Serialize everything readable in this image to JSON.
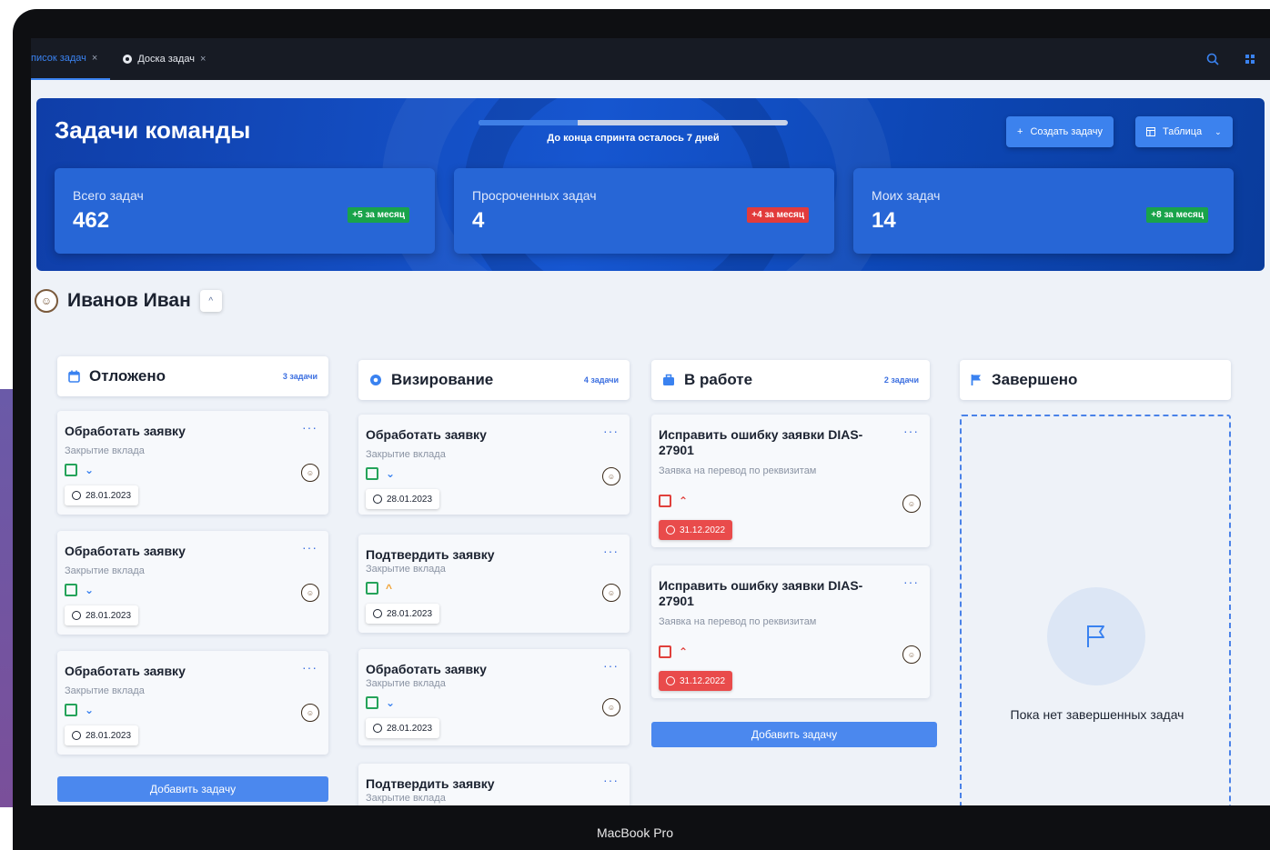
{
  "tabs": [
    {
      "label": "писок задач",
      "close": "×"
    },
    {
      "label": "Доска задач",
      "close": "×"
    }
  ],
  "header": {
    "title": "Задачи команды",
    "sprint_text": "До конца спринта осталось 7 дней",
    "sprint_progress": 0.32,
    "create_button": "Создать задачу",
    "view_button": "Таблица"
  },
  "stats": [
    {
      "label": "Всего задач",
      "value": "462",
      "badge": "+5 за месяц",
      "badge_color": "#19a34a"
    },
    {
      "label": "Просроченных задач",
      "value": "4",
      "badge": "+4 за месяц",
      "badge_color": "#e23b3b"
    },
    {
      "label": "Моих задач",
      "value": "14",
      "badge": "+8 за месяц",
      "badge_color": "#19a34a"
    }
  ],
  "user": {
    "name": "Иванов Иван"
  },
  "columns": [
    {
      "title": "Отложено",
      "count": "3 задачи",
      "icon": "calendar-icon",
      "cards": [
        {
          "title": "Обработать заявку",
          "subtitle": "Закрытие вклада",
          "date": "28.01.2023"
        },
        {
          "title": "Обработать заявку",
          "subtitle": "Закрытие вклада",
          "date": "28.01.2023"
        },
        {
          "title": "Обработать заявку",
          "subtitle": "Закрытие вклада",
          "date": "28.01.2023"
        }
      ],
      "add_label": "Добавить задачу"
    },
    {
      "title": "Визирование",
      "count": "4 задачи",
      "icon": "eye-icon",
      "cards": [
        {
          "title": "Обработать заявку",
          "subtitle": "Закрытие вклада",
          "date": "28.01.2023"
        },
        {
          "title": "Подтвердить заявку",
          "subtitle": "Закрытие вклада",
          "date": "28.01.2023"
        },
        {
          "title": "Обработать заявку",
          "subtitle": "Закрытие вклада",
          "date": "28.01.2023"
        },
        {
          "title": "Подтвердить заявку",
          "subtitle": "Закрытие вклада"
        }
      ]
    },
    {
      "title": "В работе",
      "count": "2 задачи",
      "icon": "briefcase-icon",
      "cards": [
        {
          "title": "Исправить ошибку заявки DIAS-27901",
          "subtitle": "Заявка на перевод по реквизитам",
          "date": "31.12.2022"
        },
        {
          "title": "Исправить ошибку заявки DIAS-27901",
          "subtitle": "Заявка на перевод по реквизитам",
          "date": "31.12.2022"
        }
      ],
      "add_label": "Добавить задачу"
    },
    {
      "title": "Завершено",
      "icon": "flag-icon",
      "empty_text": "Пока нет завершенных задач"
    }
  ],
  "device_label": "MacBook Pro"
}
